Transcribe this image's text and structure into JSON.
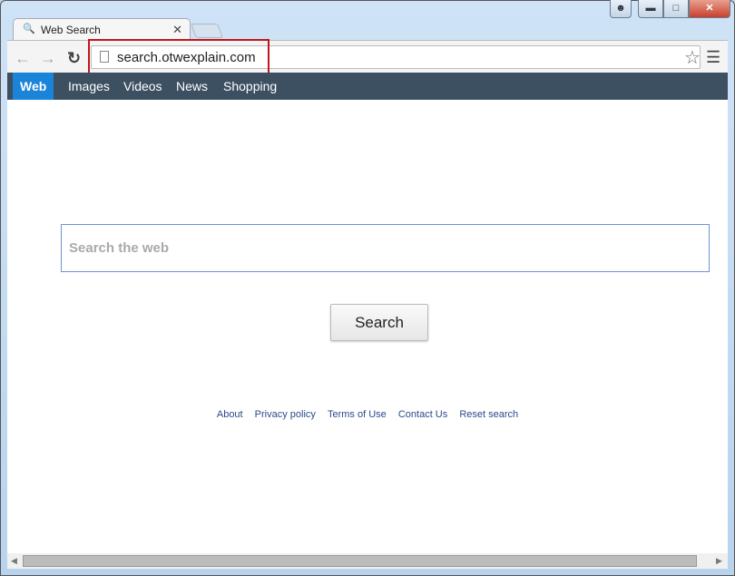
{
  "tab": {
    "title": "Web Search",
    "favicon": "search-icon"
  },
  "address": {
    "url": "search.otwexplain.com"
  },
  "categories": [
    {
      "label": "Web",
      "active": true
    },
    {
      "label": "Images"
    },
    {
      "label": "Videos"
    },
    {
      "label": "News"
    },
    {
      "label": "Shopping"
    }
  ],
  "search": {
    "placeholder": "Search the web",
    "value": "",
    "button": "Search"
  },
  "footer": [
    "About",
    "Privacy policy",
    "Terms of Use",
    "Contact Us",
    "Reset search"
  ],
  "colors": {
    "nav_bar": "#3d5061",
    "active_tab": "#1a84d8",
    "highlight_box": "#c0161c",
    "close_button": "#d4483a"
  }
}
